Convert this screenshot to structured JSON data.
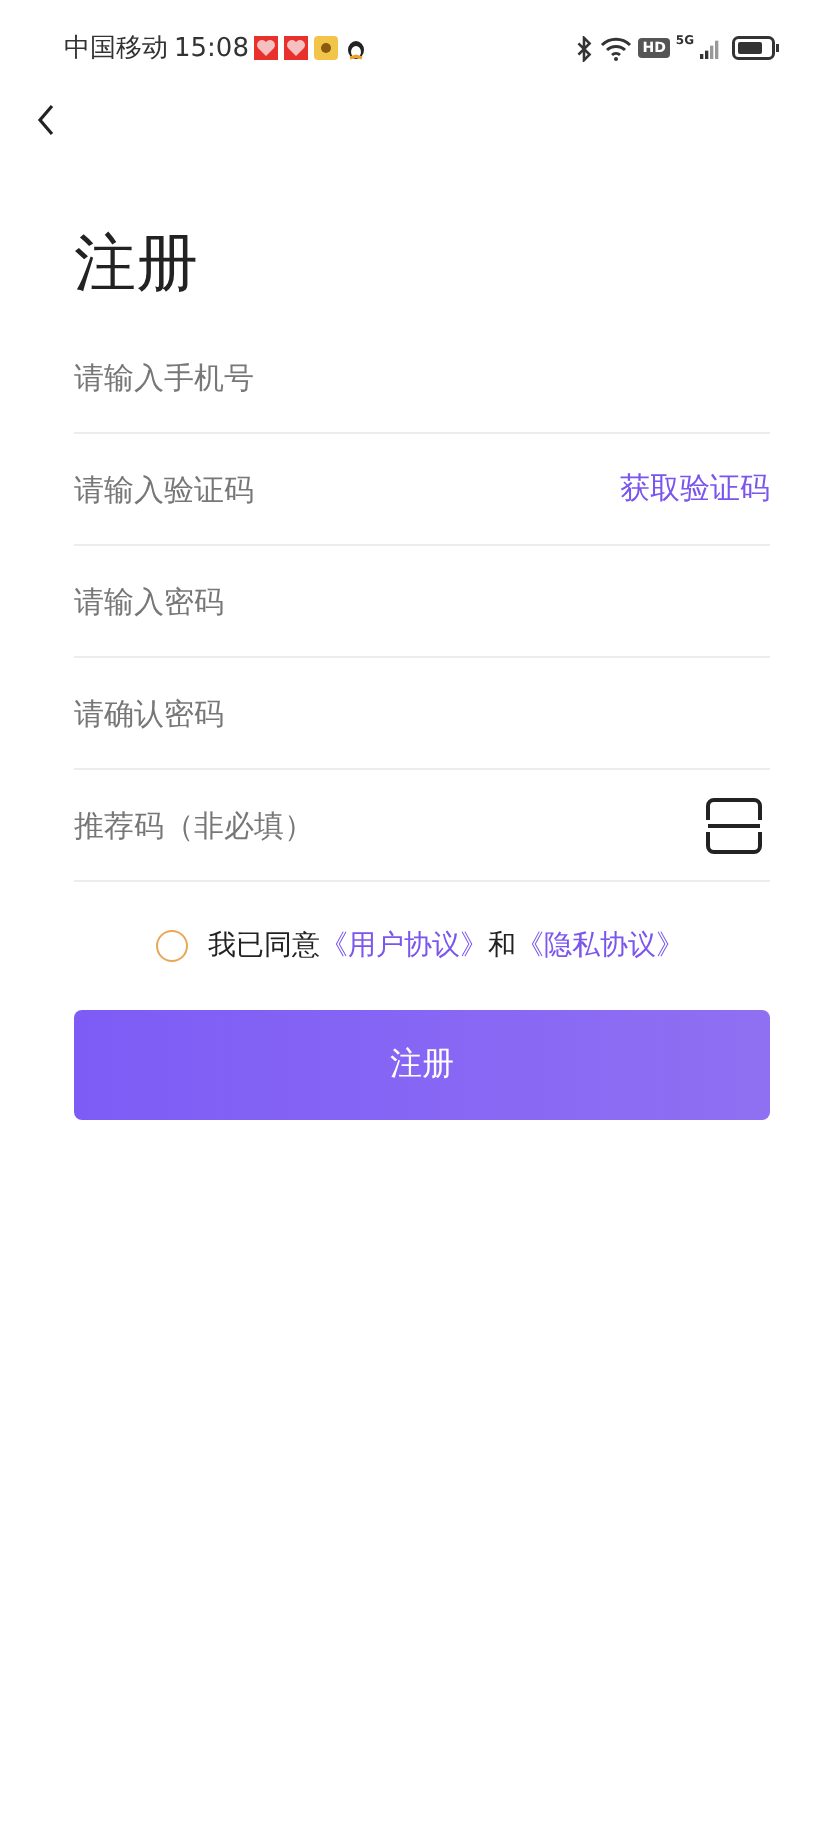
{
  "status_bar": {
    "carrier": "中国移动",
    "time": "15:08",
    "hd": "HD",
    "network": "5G"
  },
  "title": "注册",
  "fields": [
    {
      "kind": "plain",
      "placeholder": "请输入手机号"
    },
    {
      "kind": "code",
      "placeholder": "请输入验证码",
      "action": "获取验证码"
    },
    {
      "kind": "plain",
      "placeholder": "请输入密码"
    },
    {
      "kind": "plain",
      "placeholder": "请确认密码"
    },
    {
      "kind": "scan",
      "placeholder": "推荐码（非必填）"
    }
  ],
  "agreement": {
    "checked": false,
    "text": "我已同意",
    "link1": "《用户协议》",
    "joiner": "和",
    "link2": "《隐私协议》"
  },
  "submit": "注册"
}
